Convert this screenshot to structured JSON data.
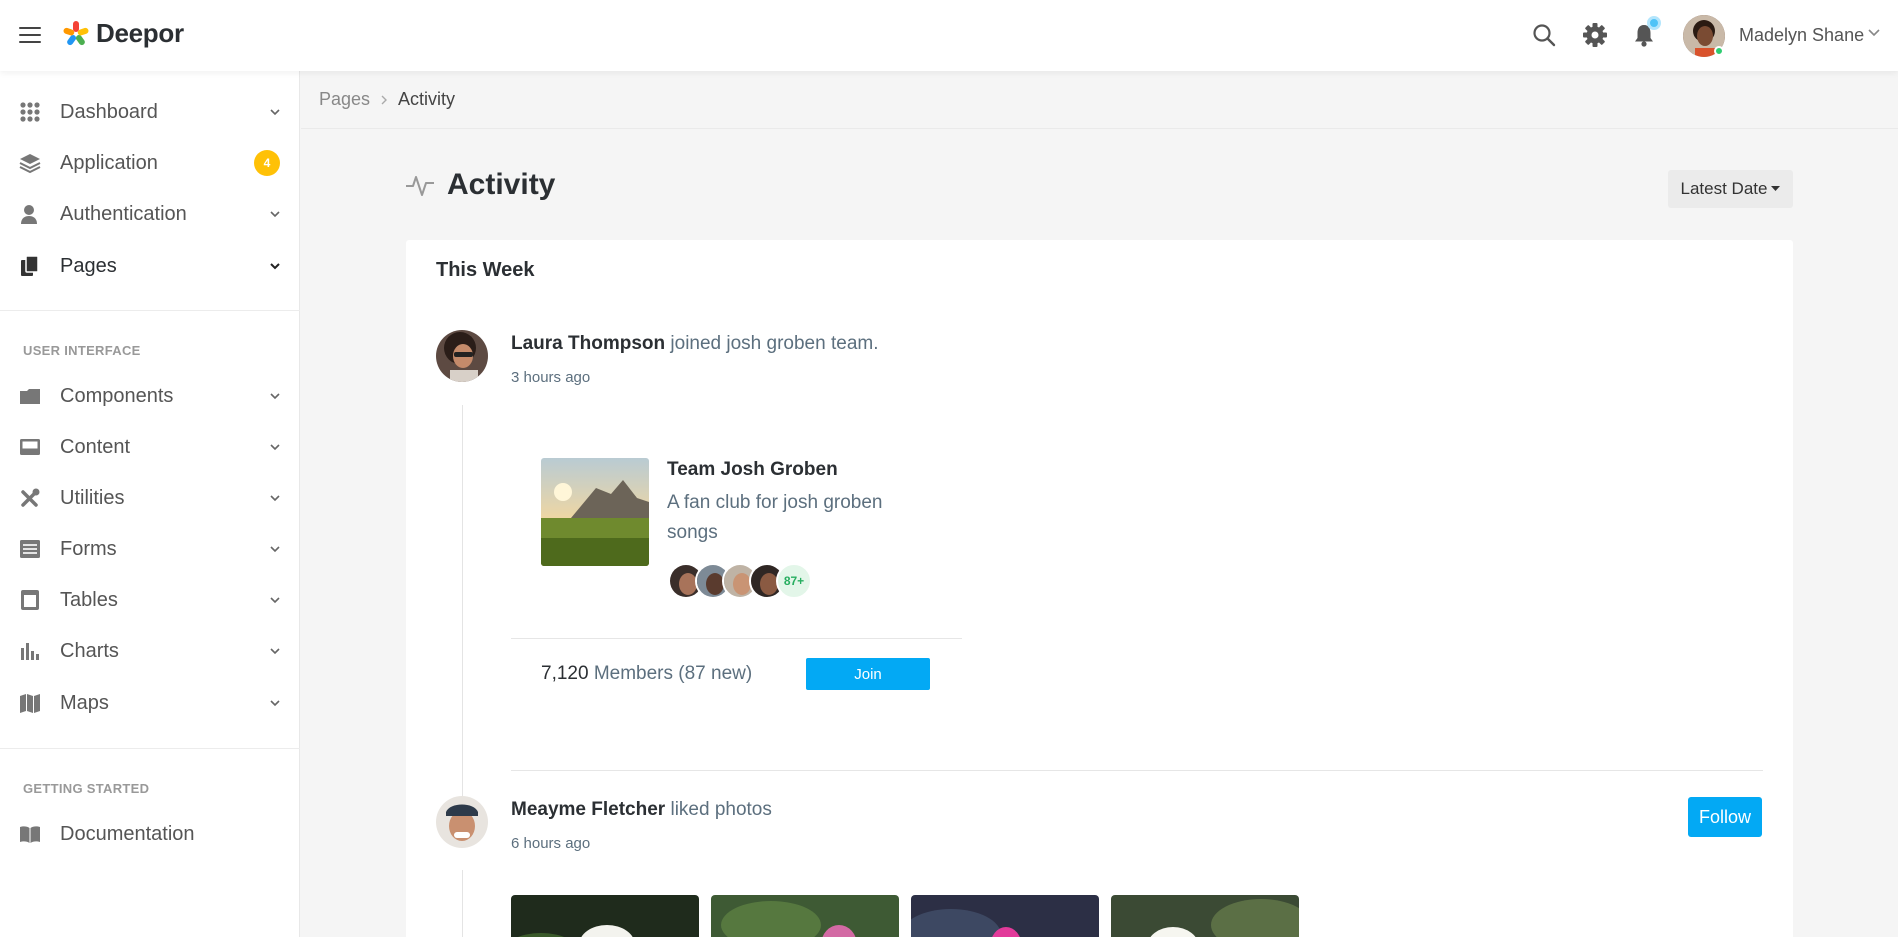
{
  "header": {
    "app_name": "Deepor",
    "user_name": "Madelyn Shane",
    "icons": [
      "menu-icon",
      "search-icon",
      "gear-icon",
      "bell-icon"
    ]
  },
  "sidebar": {
    "items": [
      {
        "label": "Dashboard",
        "icon": "grid-icon"
      },
      {
        "label": "Application",
        "icon": "layers-icon",
        "badge": "4"
      },
      {
        "label": "Authentication",
        "icon": "user-icon"
      },
      {
        "label": "Pages",
        "icon": "pages-icon"
      }
    ],
    "section_ui": "USER INTERFACE",
    "ui_items": [
      {
        "label": "Components",
        "icon": "folder-icon"
      },
      {
        "label": "Content",
        "icon": "inbox-icon"
      },
      {
        "label": "Utilities",
        "icon": "tools-icon"
      },
      {
        "label": "Forms",
        "icon": "list-icon"
      },
      {
        "label": "Tables",
        "icon": "table-icon"
      },
      {
        "label": "Charts",
        "icon": "bar-chart-icon"
      },
      {
        "label": "Maps",
        "icon": "map-icon"
      }
    ],
    "section_start": "GETTING STARTED",
    "start_items": [
      {
        "label": "Documentation",
        "icon": "book-icon"
      }
    ]
  },
  "breadcrumb": {
    "parent": "Pages",
    "current": "Activity"
  },
  "page": {
    "title": "Activity",
    "sort_label": "Latest Date"
  },
  "feed": {
    "section": "This Week",
    "activity1": {
      "actor": "Laura Thompson",
      "action": "joined josh groben team.",
      "time": "3 hours ago",
      "team_name": "Team Josh Groben",
      "team_desc": "A fan club for josh groben songs",
      "more_count": "87+",
      "members_count": "7,120",
      "members_text": "Members (87 new)",
      "join_label": "Join"
    },
    "activity2": {
      "actor": "Meayme Fletcher",
      "action": "liked photos",
      "time": "6 hours ago",
      "follow_label": "Follow"
    }
  },
  "colors": {
    "accent": "#03a9f4",
    "badge": "#ffc107",
    "online": "#2ecc71"
  }
}
